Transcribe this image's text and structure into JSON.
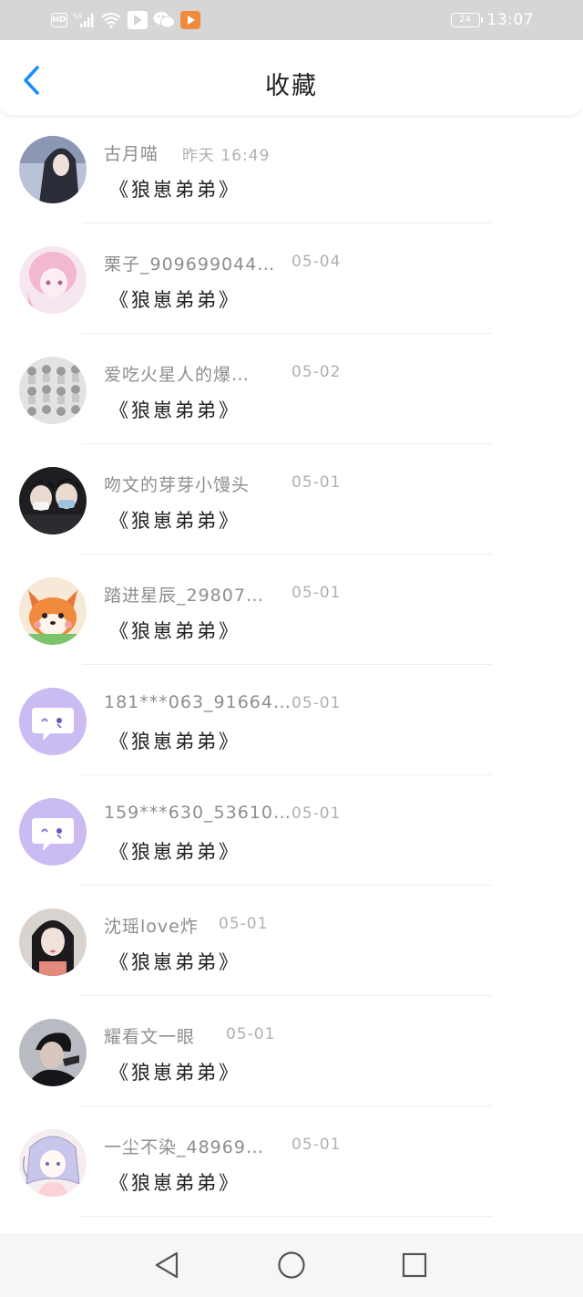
{
  "status_bar": {
    "hd": "HD",
    "network": "5G",
    "battery": "24",
    "time": "13:07"
  },
  "header": {
    "title": "收藏",
    "back_icon": "chevron-left-icon"
  },
  "colors": {
    "accent": "#1a8cff",
    "status_bar_bg": "#d6d6d6",
    "nav_bar_bg": "#f6f6f6"
  },
  "items": [
    {
      "name": "古月喵",
      "date": "昨天 16:49",
      "book": "《狼崽弟弟》",
      "avatar": "photo-avatar"
    },
    {
      "name": "栗子_909699044…",
      "date": "05-04",
      "book": "《狼崽弟弟》",
      "avatar": "anime-avatar"
    },
    {
      "name": "爱吃火星人的爆…",
      "date": "05-02",
      "book": "《狼崽弟弟》",
      "avatar": "photo-avatar"
    },
    {
      "name": "吻文的芽芽小馒头",
      "date": "05-01",
      "book": "《狼崽弟弟》",
      "avatar": "photo-avatar"
    },
    {
      "name": "踏进星辰_29807…",
      "date": "05-01",
      "book": "《狼崽弟弟》",
      "avatar": "fox-avatar"
    },
    {
      "name": "181***063_91664…",
      "date": "05-01",
      "book": "《狼崽弟弟》",
      "avatar": "default-chat-avatar"
    },
    {
      "name": "159***630_53610…",
      "date": "05-01",
      "book": "《狼崽弟弟》",
      "avatar": "default-chat-avatar"
    },
    {
      "name": "沈瑶love炸",
      "date": "05-01",
      "book": "《狼崽弟弟》",
      "avatar": "photo-avatar"
    },
    {
      "name": "耀看文一眼",
      "date": "05-01",
      "book": "《狼崽弟弟》",
      "avatar": "photo-avatar"
    },
    {
      "name": "一尘不染_48969…",
      "date": "05-01",
      "book": "《狼崽弟弟》",
      "avatar": "anime-avatar"
    }
  ],
  "nav_bar": {
    "back_icon": "triangle-back-icon",
    "home_icon": "circle-home-icon",
    "recents_icon": "square-recents-icon"
  }
}
